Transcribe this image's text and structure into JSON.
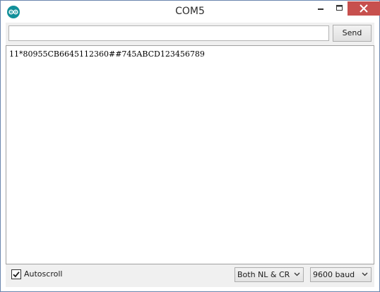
{
  "window": {
    "title": "COM5",
    "icon": "arduino-logo-icon",
    "controls": [
      "minimize-icon",
      "maximize-icon",
      "close-icon"
    ]
  },
  "input": {
    "value": "",
    "placeholder": ""
  },
  "send_label": "Send",
  "output_lines": [
    "11*80955CB6645112360##745ABCD123456789"
  ],
  "footer": {
    "autoscroll_label": "Autoscroll",
    "autoscroll_checked": true,
    "line_ending": "Both NL & CR",
    "baud_rate": "9600 baud"
  },
  "colors": {
    "border": "#6a86ad",
    "close_button": "#c7504e",
    "app_icon": "#12909a",
    "client_bg": "#f0f0f0"
  }
}
